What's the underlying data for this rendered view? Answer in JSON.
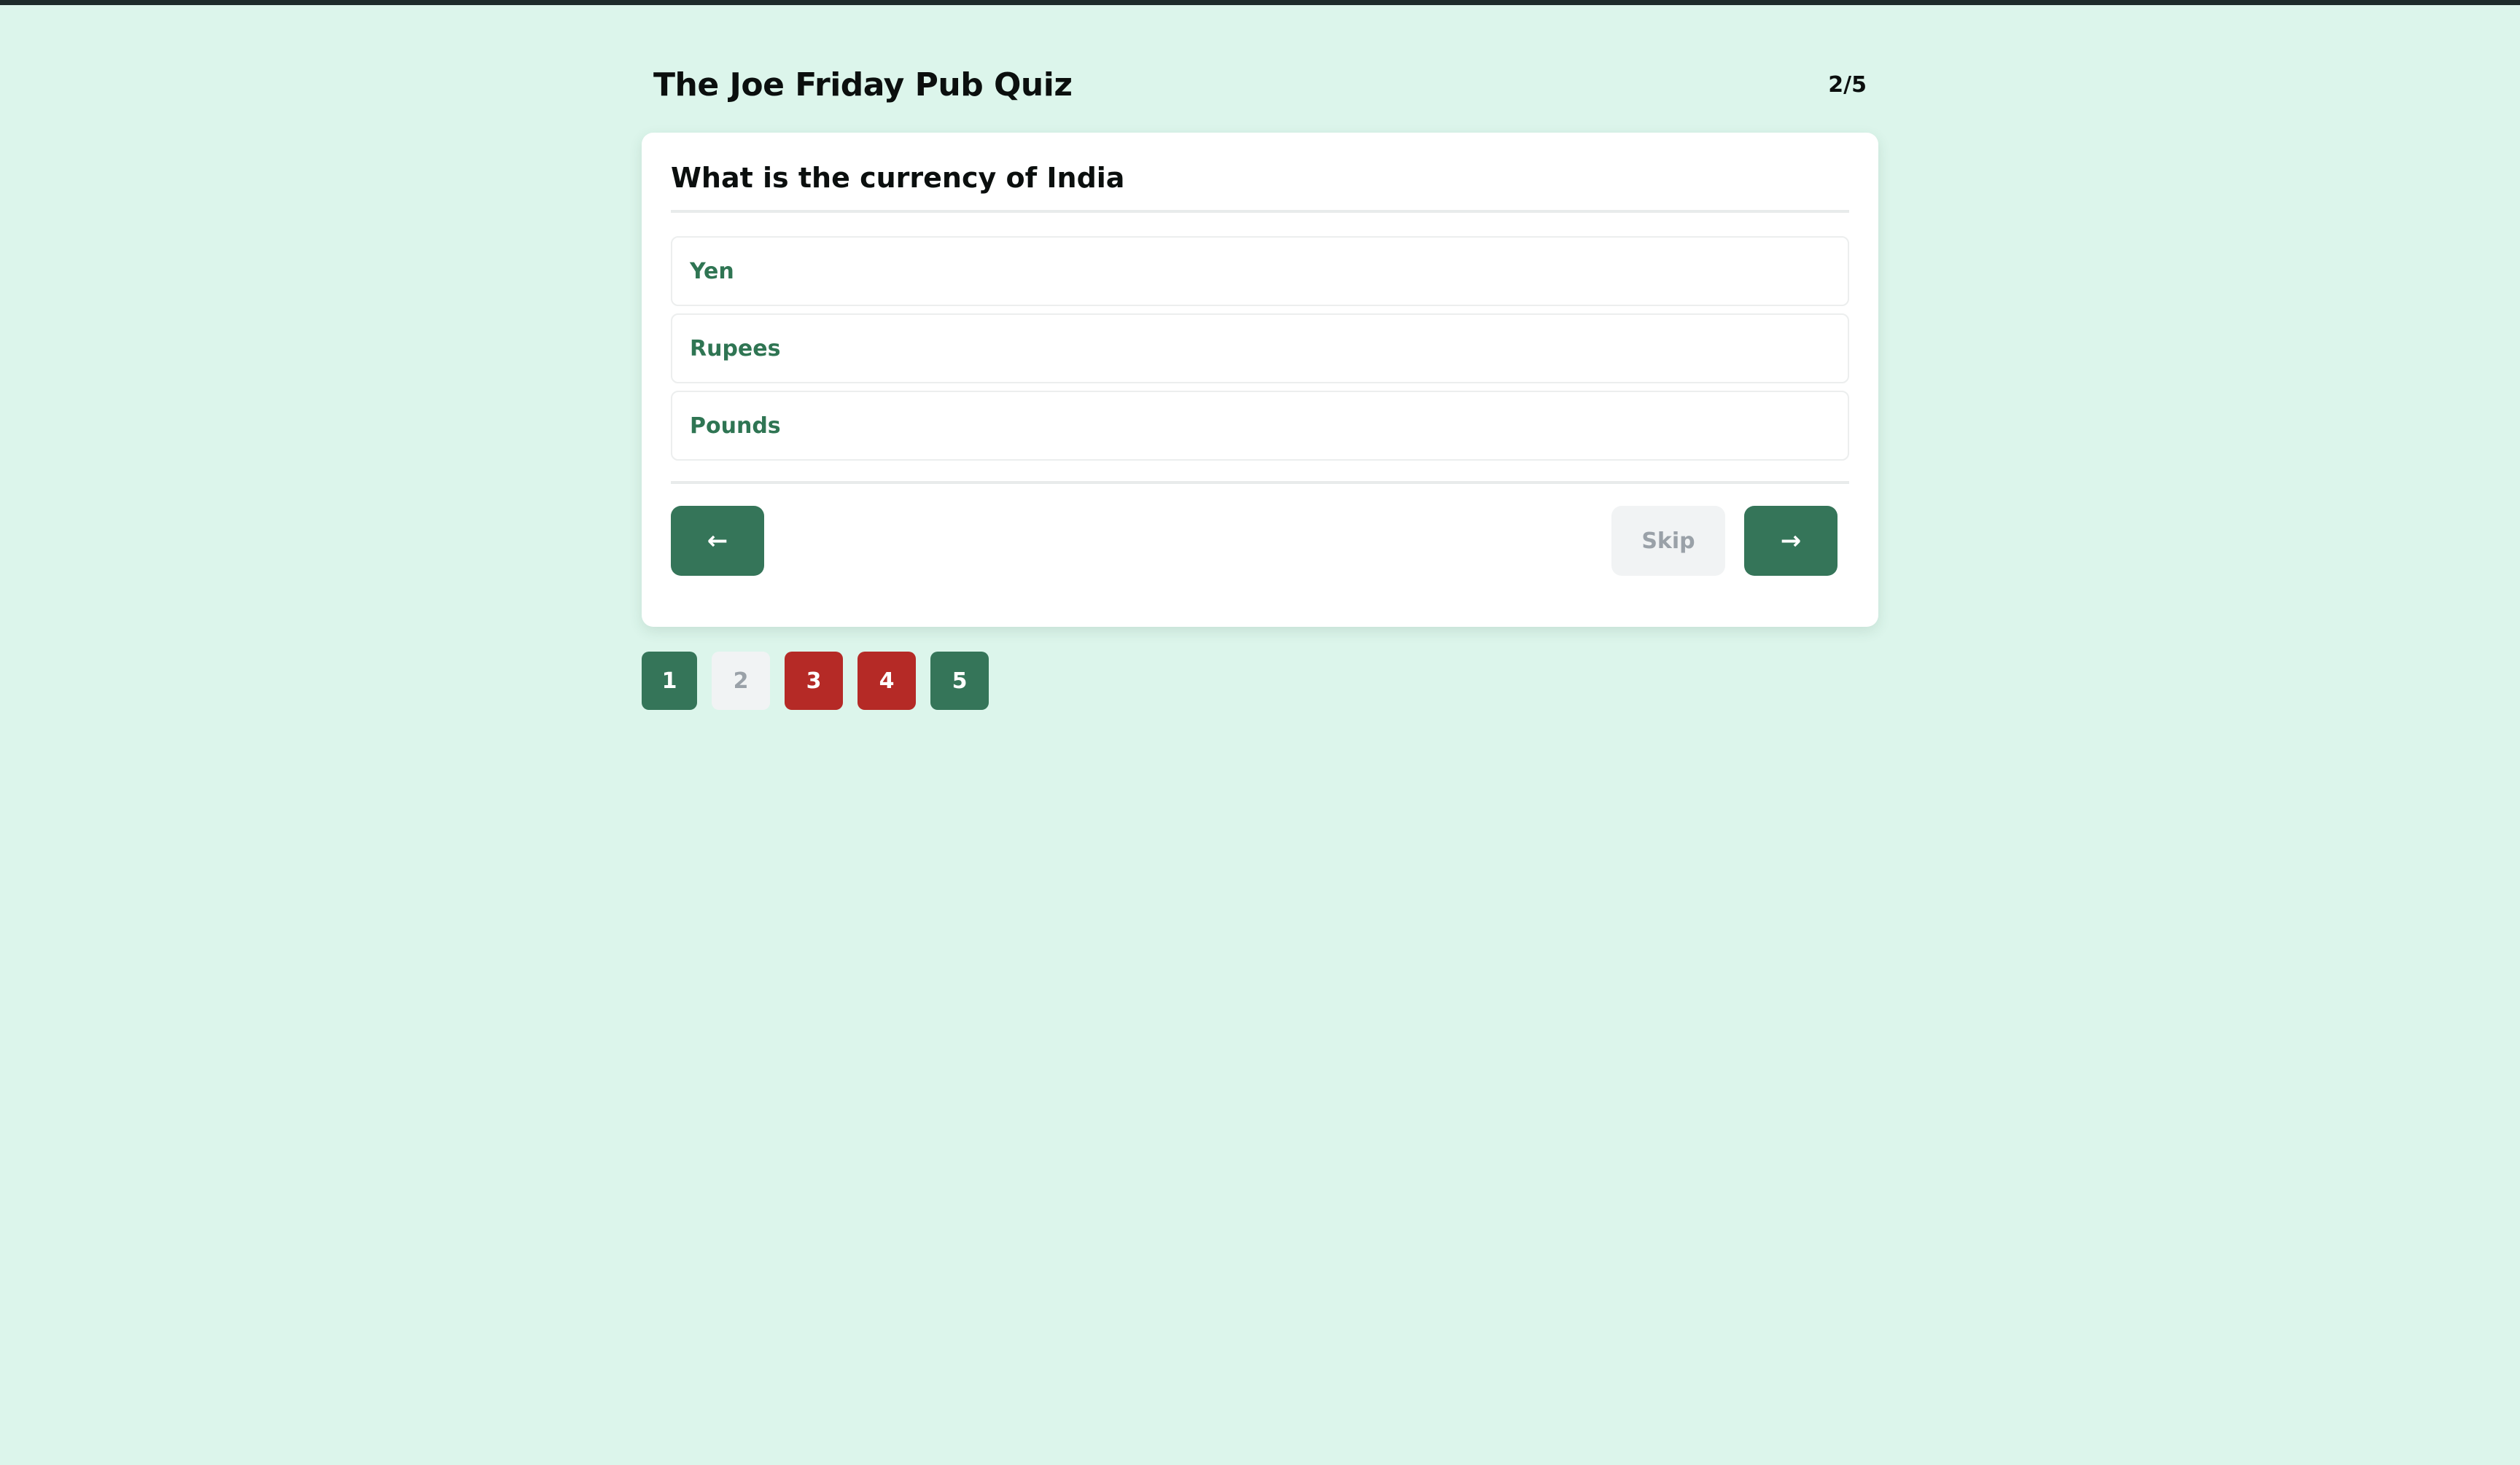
{
  "quiz": {
    "title": "The Joe Friday Pub Quiz",
    "progress": "2/5"
  },
  "question": {
    "text": "What is the currency of India",
    "options": [
      {
        "label": "Yen"
      },
      {
        "label": "Rupees"
      },
      {
        "label": "Pounds"
      }
    ]
  },
  "navigation": {
    "prev_icon": "←",
    "skip_label": "Skip",
    "next_icon": "→"
  },
  "pager": {
    "pages": [
      {
        "label": "1",
        "state": "answered"
      },
      {
        "label": "2",
        "state": "current"
      },
      {
        "label": "3",
        "state": "wrong"
      },
      {
        "label": "4",
        "state": "wrong"
      },
      {
        "label": "5",
        "state": "answered"
      }
    ]
  },
  "colors": {
    "background": "#dcf5eb",
    "primary_green": "#357559",
    "wrong_red": "#b52a26",
    "option_text": "#2f7553",
    "muted": "#f1f3f4"
  }
}
